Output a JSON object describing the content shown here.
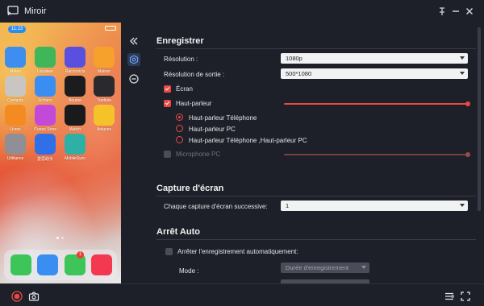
{
  "window": {
    "title": "Miroir",
    "buttons": {
      "pin": "pin-icon",
      "minimize": "minimize-icon",
      "close": "close-icon"
    }
  },
  "phone": {
    "time": "11:23",
    "apps": [
      {
        "label": "Météo",
        "color": "#3e8ef0",
        "icon": "weather-icon"
      },
      {
        "label": "Localiser",
        "color": "#3fb65a",
        "icon": "find-my-icon"
      },
      {
        "label": "Raccourcis",
        "color": "#5b4fe0",
        "icon": "shortcuts-icon"
      },
      {
        "label": "Maison",
        "color": "#f6a12b",
        "icon": "home-icon"
      },
      {
        "label": "Contacts",
        "color": "#c9c6c1",
        "icon": "contacts-icon"
      },
      {
        "label": "Fichiers",
        "color": "#3a8ef2",
        "icon": "files-icon"
      },
      {
        "label": "Bourse",
        "color": "#1c1c1e",
        "icon": "stocks-icon"
      },
      {
        "label": "Traduire",
        "color": "#2a2a2e",
        "icon": "translate-icon"
      },
      {
        "label": "Livres",
        "color": "#f38b22",
        "icon": "books-icon"
      },
      {
        "label": "iTunes Store",
        "color": "#c34ad8",
        "icon": "itunes-store-icon"
      },
      {
        "label": "Watch",
        "color": "#1a1a1c",
        "icon": "watch-icon"
      },
      {
        "label": "Astuces",
        "color": "#f5c229",
        "icon": "tips-icon"
      },
      {
        "label": "Utilitaires",
        "color": "#8f8f95",
        "icon": "utilities-folder-icon"
      },
      {
        "label": "愛思助手",
        "color": "#2f6fe8",
        "icon": "assistant-icon"
      },
      {
        "label": "MobileSync",
        "color": "#2fb0a4",
        "icon": "mobilesync-icon"
      }
    ],
    "dock": [
      {
        "color": "#3ec55a",
        "icon": "phone-icon"
      },
      {
        "color": "#3a8ef2",
        "icon": "safari-icon"
      },
      {
        "color": "#3ec55a",
        "icon": "messages-icon"
      },
      {
        "color": "#f2394f",
        "icon": "music-icon"
      }
    ],
    "messages_badge": "1"
  },
  "nav": {
    "collapse_icon": "collapse-icon",
    "settings_icon": "record-settings-icon",
    "minus_icon": "remove-icon"
  },
  "settings": {
    "record": {
      "title": "Enregistrer",
      "resolution_label": "Résolution :",
      "resolution_value": "1080p",
      "output_resolution_label": "Résolution de sortie :",
      "output_resolution_value": "500*1080",
      "screen_label": "Écran",
      "screen_checked": true,
      "speaker_label": "Haut-parleur",
      "speaker_checked": true,
      "speaker_volume": 1.0,
      "audio_sources": [
        {
          "label": "Haut-parleur Téléphone",
          "selected": true
        },
        {
          "label": "Haut-parleur PC",
          "selected": false
        },
        {
          "label": "Haut-parleur Téléphone ,Haut-parleur PC",
          "selected": false
        }
      ],
      "microphone_label": "Microphone PC",
      "microphone_checked": false,
      "microphone_volume": 1.0
    },
    "capture": {
      "title": "Capture d'écran",
      "successive_label": "Chaque capture d'écran successive:",
      "successive_value": "1"
    },
    "auto_stop": {
      "title": "Arrêt Auto",
      "stop_label": "Arrêter l'enregistrement automatiquement:",
      "stop_checked": false,
      "mode_label": "Mode :",
      "mode_value": "Durée d'enregistrement"
    }
  },
  "bottom": {
    "record_icon": "record-icon",
    "camera_icon": "camera-icon",
    "list_icon": "list-settings-icon",
    "expand_icon": "fullscreen-icon"
  },
  "colors": {
    "accent": "#ea4a45",
    "background": "#1e2029",
    "highlight": "#6d9cf0"
  }
}
